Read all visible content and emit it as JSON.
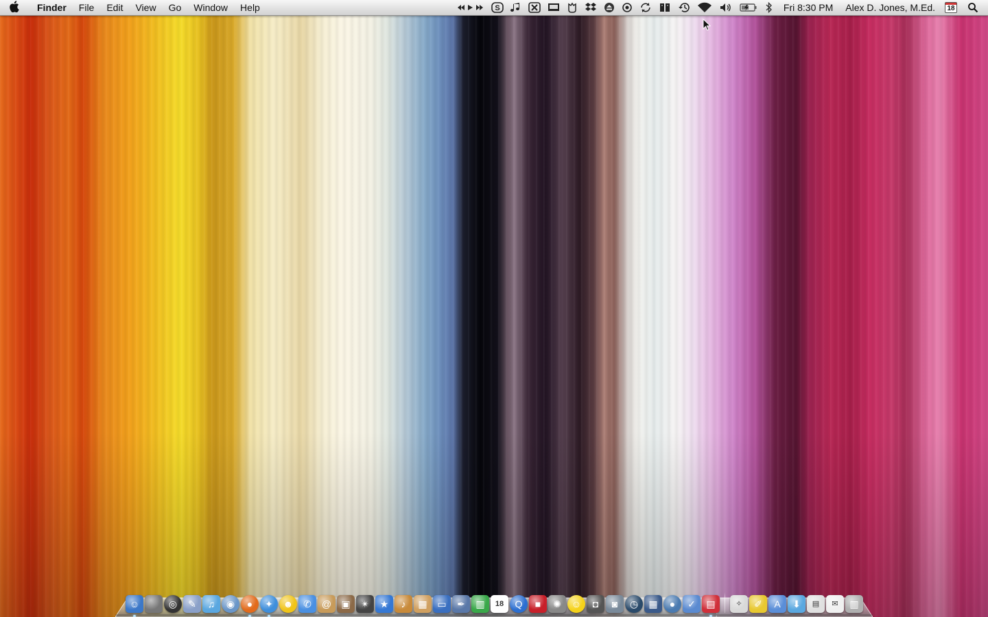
{
  "menubar": {
    "app_name": "Finder",
    "menus": [
      "File",
      "Edit",
      "View",
      "Go",
      "Window",
      "Help"
    ],
    "clock": "Fri 8:30 PM",
    "user": "Alex D. Jones, M.Ed.",
    "calendar_day": "18",
    "status_icons": [
      "media-controls-icon",
      "skype-icon",
      "itunes-note-icon",
      "x-app-icon",
      "display-icon",
      "growl-icon",
      "dropbox-icon",
      "eject-icon",
      "sync-circle-icon",
      "sync-arrows-icon",
      "book-icon",
      "time-machine-icon",
      "wifi-icon",
      "volume-icon",
      "battery-icon",
      "bluetooth-icon"
    ]
  },
  "dock": {
    "apps": [
      {
        "name": "finder-icon",
        "color": "#3c78c8",
        "glyph": "☺",
        "running": true
      },
      {
        "name": "system-preferences-icon",
        "color": "#777777",
        "glyph": "",
        "running": false
      },
      {
        "name": "dashboard-icon",
        "color": "#333333",
        "glyph": "◎",
        "running": false
      },
      {
        "name": "textedit-icon",
        "color": "#8aa0c8",
        "glyph": "✎",
        "running": false
      },
      {
        "name": "itunes-icon",
        "color": "#5aa7e0",
        "glyph": "♫",
        "running": false
      },
      {
        "name": "network-globe-icon",
        "color": "#6a96c8",
        "glyph": "◉",
        "running": false
      },
      {
        "name": "firefox-icon",
        "color": "#e26b1c",
        "glyph": "●",
        "running": true
      },
      {
        "name": "safari-icon",
        "color": "#3f8fdc",
        "glyph": "✦",
        "running": true
      },
      {
        "name": "smiley-messenger-icon",
        "color": "#f0c419",
        "glyph": "☻",
        "running": false
      },
      {
        "name": "ichat-icon",
        "color": "#4a90e2",
        "glyph": "✆",
        "running": false
      },
      {
        "name": "address-book-icon",
        "color": "#c89b5a",
        "glyph": "@",
        "running": false
      },
      {
        "name": "iphoto-icon",
        "color": "#8c6a48",
        "glyph": "▣",
        "running": false
      },
      {
        "name": "aperture-icon",
        "color": "#444444",
        "glyph": "✴",
        "running": false
      },
      {
        "name": "imovie-icon",
        "color": "#3578d4",
        "glyph": "★",
        "running": false
      },
      {
        "name": "garageband-icon",
        "color": "#c88a3a",
        "glyph": "♪",
        "running": false
      },
      {
        "name": "preview-icon",
        "color": "#d0a060",
        "glyph": "▦",
        "running": false
      },
      {
        "name": "keynote-icon",
        "color": "#3a6fc0",
        "glyph": "▭",
        "running": false
      },
      {
        "name": "pages-icon",
        "color": "#5a78a8",
        "glyph": "✒",
        "running": false
      },
      {
        "name": "numbers-icon",
        "color": "#3aa84a",
        "glyph": "▥",
        "running": false
      },
      {
        "name": "ical-icon",
        "color": "#ffffff",
        "glyph": "18",
        "running": false
      },
      {
        "name": "quicktime-icon",
        "color": "#2c6fd1",
        "glyph": "Q",
        "running": false
      },
      {
        "name": "red-folder-icon",
        "color": "#c8202a",
        "glyph": "■",
        "running": false
      },
      {
        "name": "photo-booth-icon",
        "color": "#888888",
        "glyph": "✺",
        "running": false
      },
      {
        "name": "yellow-smiley-icon",
        "color": "#f5d21a",
        "glyph": "☺",
        "running": false
      },
      {
        "name": "camera-icon",
        "color": "#555555",
        "glyph": "◘",
        "running": false
      },
      {
        "name": "image-capture-icon",
        "color": "#7a8a9a",
        "glyph": "◙",
        "running": false
      },
      {
        "name": "time-machine-dock-icon",
        "color": "#2a4a6a",
        "glyph": "◷",
        "running": false
      },
      {
        "name": "spaces-icon",
        "color": "#3a5a8a",
        "glyph": "▦",
        "running": false
      },
      {
        "name": "network-utility-icon",
        "color": "#4a7ab0",
        "glyph": "●",
        "running": false
      },
      {
        "name": "dictionary-icon",
        "color": "#5a8ad0",
        "glyph": "✓",
        "running": false
      },
      {
        "name": "parallels-icon",
        "color": "#d0303a",
        "glyph": "▤",
        "running": true
      }
    ],
    "stacks": [
      {
        "name": "lightbulb-icon",
        "color": "#d9d9d9",
        "glyph": "✧"
      },
      {
        "name": "notes-folder-icon",
        "color": "#e8c830",
        "glyph": "✐"
      },
      {
        "name": "applications-folder-icon",
        "color": "#5a8ed8",
        "glyph": "A"
      },
      {
        "name": "downloads-folder-icon",
        "color": "#5aa8e0",
        "glyph": "⬇"
      },
      {
        "name": "documents-stack-icon",
        "color": "#e0e0e0",
        "glyph": "▤"
      },
      {
        "name": "mail-stack-icon",
        "color": "#f0f0f0",
        "glyph": "✉"
      },
      {
        "name": "trash-icon",
        "color": "#b0b0b0",
        "glyph": "▥"
      }
    ]
  }
}
